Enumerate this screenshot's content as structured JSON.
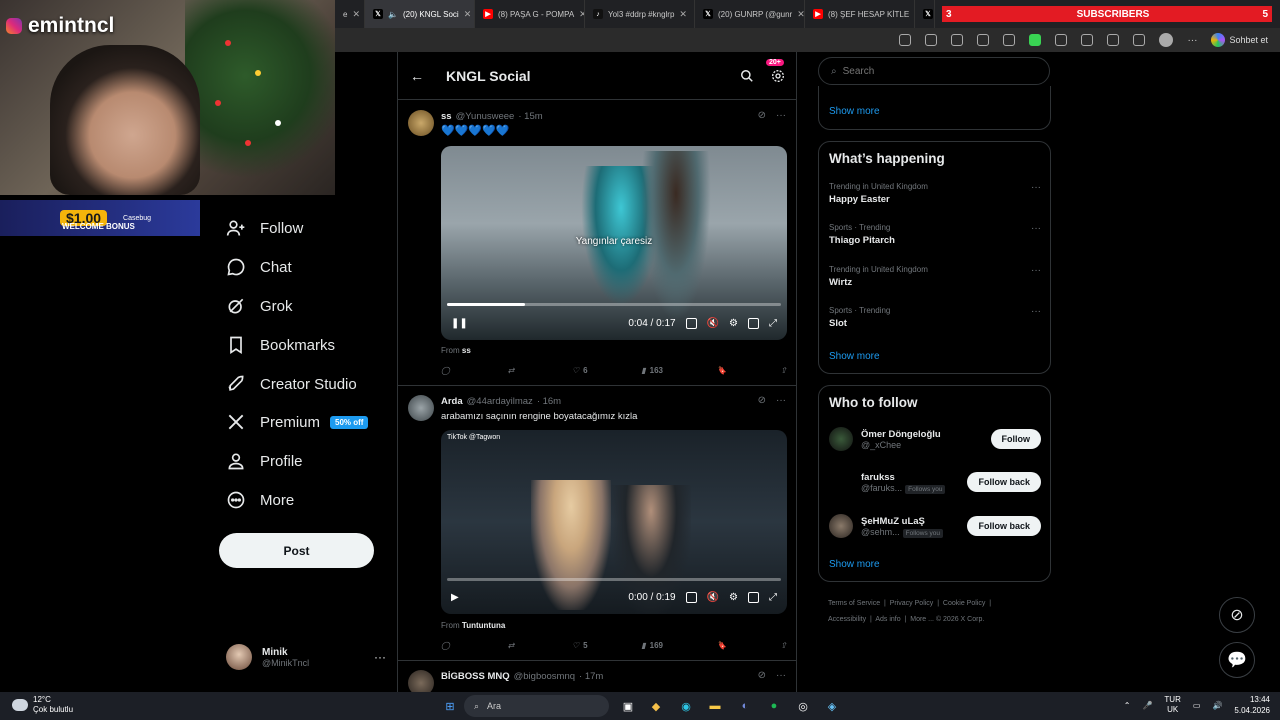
{
  "streamer": {
    "name": "emintncl"
  },
  "casino": {
    "amount": "$1.00",
    "label": "WELCOME BONUS",
    "brand": "Casebug"
  },
  "browser": {
    "tabs": [
      {
        "label": "e",
        "icon": "generic"
      },
      {
        "label": "(20) KNGL Soci",
        "icon": "x-logo"
      },
      {
        "label": "(8) PAŞA G - POMPA",
        "icon": "youtube"
      },
      {
        "label": "Yol3 #ddrp #knglrp",
        "icon": "tiktok"
      },
      {
        "label": "(20) GUNRP (@gunr",
        "icon": "x-logo"
      },
      {
        "label": "(8) ŞEF HESAP KİTLE",
        "icon": "youtube"
      }
    ],
    "subscriber_count": "3",
    "subscriber_label": "SUBSCRIBERS",
    "subscriber_right": "5",
    "chat_button": "Sohbet et"
  },
  "nav": {
    "items": [
      {
        "label": "Follow",
        "icon": "person-plus-icon"
      },
      {
        "label": "Chat",
        "icon": "chat-icon"
      },
      {
        "label": "Grok",
        "icon": "grok-icon"
      },
      {
        "label": "Bookmarks",
        "icon": "bookmark-icon"
      },
      {
        "label": "Creator Studio",
        "icon": "rocket-icon"
      },
      {
        "label": "Premium",
        "icon": "x-icon",
        "badge": "50% off"
      },
      {
        "label": "Profile",
        "icon": "person-icon"
      },
      {
        "label": "More",
        "icon": "more-circle-icon"
      }
    ],
    "post_button": "Post",
    "account": {
      "name": "Minik",
      "handle": "@MinikTncl"
    }
  },
  "feed": {
    "title": "KNGL Social",
    "notif_badge": "20+",
    "tweets": [
      {
        "name": "ss",
        "handle": "@Yunusweee",
        "time": "· 15m",
        "text": "💙💙💙💙💙",
        "video": {
          "caption": "Yangınlar çaresiz",
          "time": "0:04 / 0:17",
          "progress": 0.235,
          "state": "playing"
        },
        "from_label": "From",
        "from_name": "ss",
        "replies": "",
        "reposts": "",
        "likes": "6",
        "views": "163"
      },
      {
        "name": "Arda",
        "handle": "@44ardayilmaz",
        "time": "· 16m",
        "text": "arabamızı saçının rengine boyatacağımız kızla",
        "video": {
          "caption": "TikTok @Tagwon",
          "time": "0:00 / 0:19",
          "progress": 0.0,
          "state": "paused"
        },
        "from_label": "From",
        "from_name": "Tuntuntuna",
        "replies": "",
        "reposts": "",
        "likes": "5",
        "views": "169"
      },
      {
        "name": "BİGBOSS MNQ",
        "handle": "@bigboosmnq",
        "time": "· 17m"
      }
    ]
  },
  "right": {
    "search_placeholder": "Search",
    "show_more": "Show more",
    "happening_title": "What’s happening",
    "trends": [
      {
        "category": "Trending in United Kingdom",
        "name": "Happy Easter"
      },
      {
        "category": "Sports · Trending",
        "name": "Thiago Pitarch"
      },
      {
        "category": "Trending in United Kingdom",
        "name": "Wirtz"
      },
      {
        "category": "Sports · Trending",
        "name": "Slot"
      }
    ],
    "wtf_title": "Who to follow",
    "wtf": [
      {
        "name": "Ömer Döngeloğlu",
        "handle": "@_xChee",
        "follows_you": "",
        "button": "Follow"
      },
      {
        "name": "farukss",
        "handle": "@faruks...",
        "follows_you": "Follows you",
        "button": "Follow back"
      },
      {
        "name": "ŞeHMuZ uLaŞ",
        "handle": "@sehm...",
        "follows_you": "Follows you",
        "button": "Follow back"
      }
    ],
    "footer": [
      "Terms of Service",
      "Privacy Policy",
      "Cookie Policy",
      "Accessibility",
      "Ads info",
      "More ...",
      "© 2026 X Corp."
    ]
  },
  "taskbar": {
    "temp": "12°C",
    "weather": "Çok bulutlu",
    "search": "Ara",
    "lang_top": "TUR",
    "lang_bottom": "UK",
    "time": "13:44",
    "date": "5.04.2026"
  }
}
